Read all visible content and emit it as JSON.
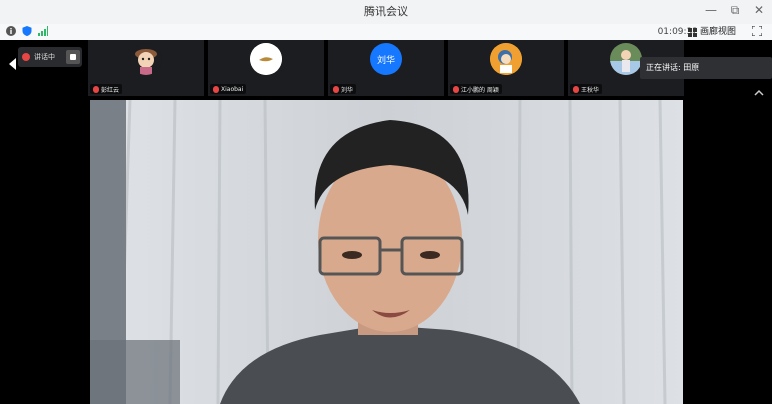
{
  "window": {
    "title": "腾讯会议",
    "controls": [
      "—",
      "⧉",
      "✕"
    ]
  },
  "toolbar": {
    "timer": "01:09:32",
    "layout_label": "画廊视图",
    "icons": [
      "info-icon",
      "shield-icon",
      "signal-icon",
      "grid-icon",
      "fullscreen-icon"
    ]
  },
  "self_control": {
    "label": "讲话中"
  },
  "participants": [
    {
      "name": "彭红云",
      "avatar_text": "",
      "avatar_color": "#c98a5e"
    },
    {
      "name": "Xiaobai",
      "avatar_text": "",
      "avatar_color": "#ffffff"
    },
    {
      "name": "刘华",
      "avatar_text": "刘华",
      "avatar_color": "#1677ff"
    },
    {
      "name": "江小鹏的 周颖",
      "avatar_text": "",
      "avatar_color": "#f0a030"
    },
    {
      "name": "王秋华",
      "avatar_text": "",
      "avatar_color": "#6a8c5a"
    }
  ],
  "tooltip": {
    "text": "正在讲话: 田原"
  },
  "colors": {
    "accent": "#1677ff",
    "mic_muted": "#e84545",
    "signal": "#2fb866"
  }
}
